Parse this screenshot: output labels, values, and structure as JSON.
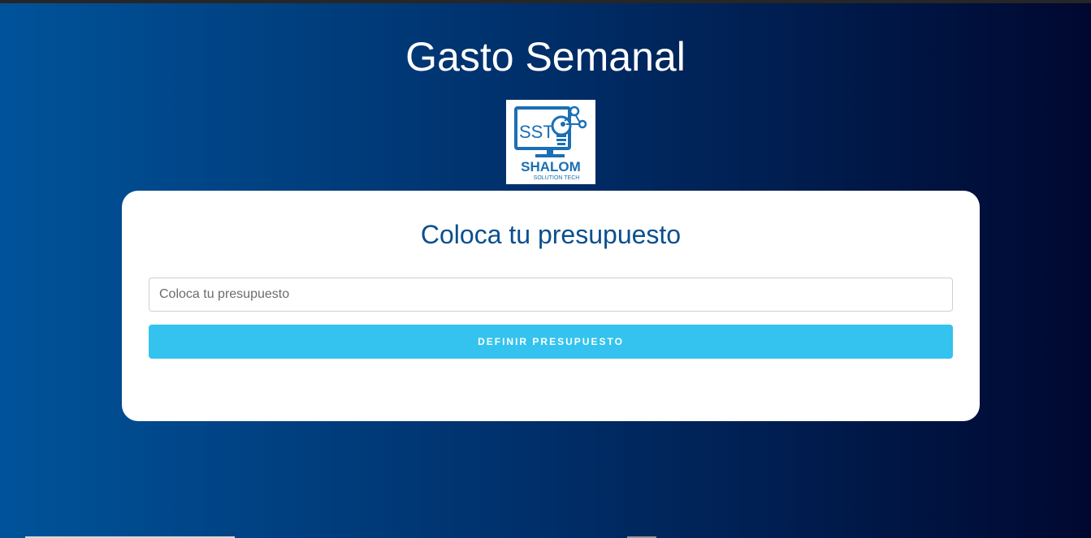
{
  "page": {
    "title": "Gasto Semanal"
  },
  "logo": {
    "abbr": "SST",
    "name": "SHALOM",
    "tagline": "SOLUTION TECH",
    "color": "#1a6fb5"
  },
  "card": {
    "heading": "Coloca tu presupuesto",
    "input_placeholder": "Coloca tu presupuesto",
    "input_value": "",
    "button_label": "Definir presupuesto"
  },
  "colors": {
    "background_left": "#00539a",
    "background_right": "#000830",
    "heading": "#0a4f8f",
    "button": "#33c3ee"
  }
}
